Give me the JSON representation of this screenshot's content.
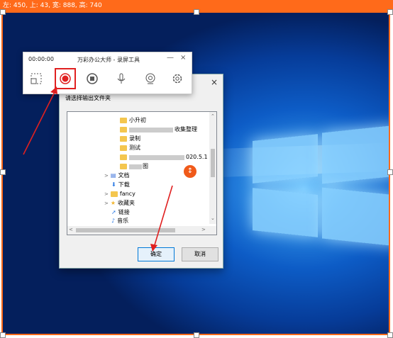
{
  "topbar": {
    "info": "左: 450, 上: 43, 宽: 888, 高: 740"
  },
  "recorder": {
    "time": "00:00:00",
    "title": "万彩办公大师 - 录屏工具",
    "minimize": "—",
    "close": "×",
    "tools": [
      "region-select-icon",
      "record-icon",
      "stop-icon",
      "microphone-icon",
      "webcam-icon",
      "settings-icon"
    ]
  },
  "dialog": {
    "prompt": "请选择输出文件夹",
    "close": "×",
    "tree": [
      {
        "label": "小升初",
        "type": "folder"
      },
      {
        "label": "收集整理",
        "type": "folder"
      },
      {
        "label": "录制",
        "type": "folder"
      },
      {
        "label": "测试",
        "type": "folder"
      },
      {
        "label": "020.5.1",
        "type": "folder"
      },
      {
        "label": "图",
        "type": "folder"
      },
      {
        "label": "文档",
        "type": "doc"
      },
      {
        "label": "下载",
        "type": "download"
      },
      {
        "label": "fancy",
        "type": "folder"
      },
      {
        "label": "收藏夹",
        "type": "star"
      },
      {
        "label": "链接",
        "type": "link"
      },
      {
        "label": "音乐",
        "type": "music"
      }
    ],
    "ok": "确定",
    "cancel": "取消"
  },
  "colors": {
    "accent": "#ff6a1a",
    "record": "#e02020",
    "badge": "#f05a1a"
  }
}
